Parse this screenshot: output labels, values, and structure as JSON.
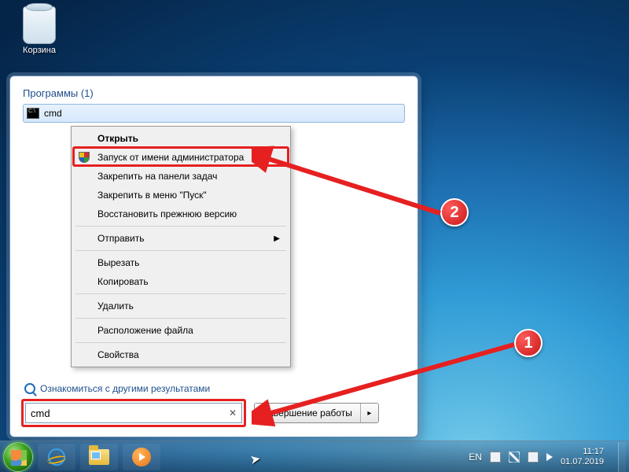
{
  "desktop": {
    "recycle_bin": "Корзина"
  },
  "start_panel": {
    "section_title": "Программы (1)",
    "result_name": "cmd",
    "see_more": "Ознакомиться с другими результатами",
    "search_value": "cmd",
    "shutdown_label": "Завершение работы"
  },
  "context_menu": {
    "open": "Открыть",
    "run_admin": "Запуск от имени администратора",
    "pin_taskbar": "Закрепить на панели задач",
    "pin_start": "Закрепить в меню \"Пуск\"",
    "restore": "Восстановить прежнюю версию",
    "send_to": "Отправить",
    "cut": "Вырезать",
    "copy": "Копировать",
    "delete": "Удалить",
    "location": "Расположение файла",
    "properties": "Свойства"
  },
  "annotations": {
    "one": "1",
    "two": "2"
  },
  "tray": {
    "lang": "EN",
    "time": "11:17",
    "date": "01.07.2019"
  }
}
